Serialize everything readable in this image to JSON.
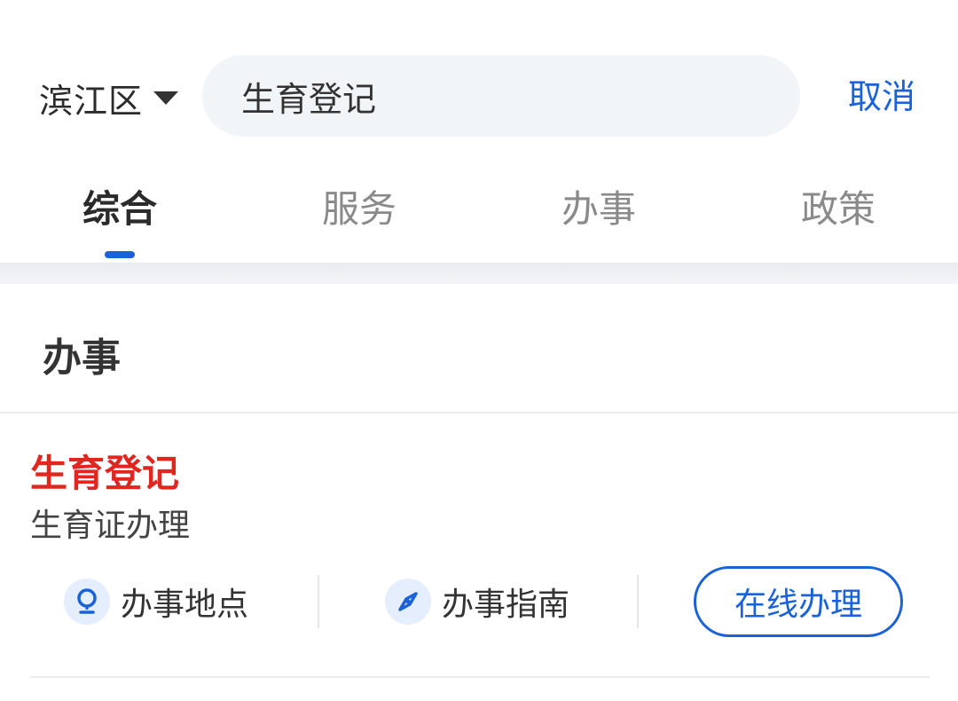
{
  "header": {
    "region": "滨江区",
    "search_value": "生育登记",
    "cancel_label": "取消"
  },
  "tabs": [
    {
      "label": "综合",
      "active": true
    },
    {
      "label": "服务",
      "active": false
    },
    {
      "label": "办事",
      "active": false
    },
    {
      "label": "政策",
      "active": false
    }
  ],
  "section": {
    "title": "办事"
  },
  "result": {
    "title": "生育登记",
    "subtitle": "生育证办理",
    "actions": [
      {
        "label": "办事地点",
        "icon": "location-pin-icon"
      },
      {
        "label": "办事指南",
        "icon": "compass-icon"
      }
    ],
    "online_label": "在线办理"
  },
  "colors": {
    "accent": "#1b62d9",
    "highlight": "#e0271f",
    "search_bg": "#f1f5f7"
  }
}
